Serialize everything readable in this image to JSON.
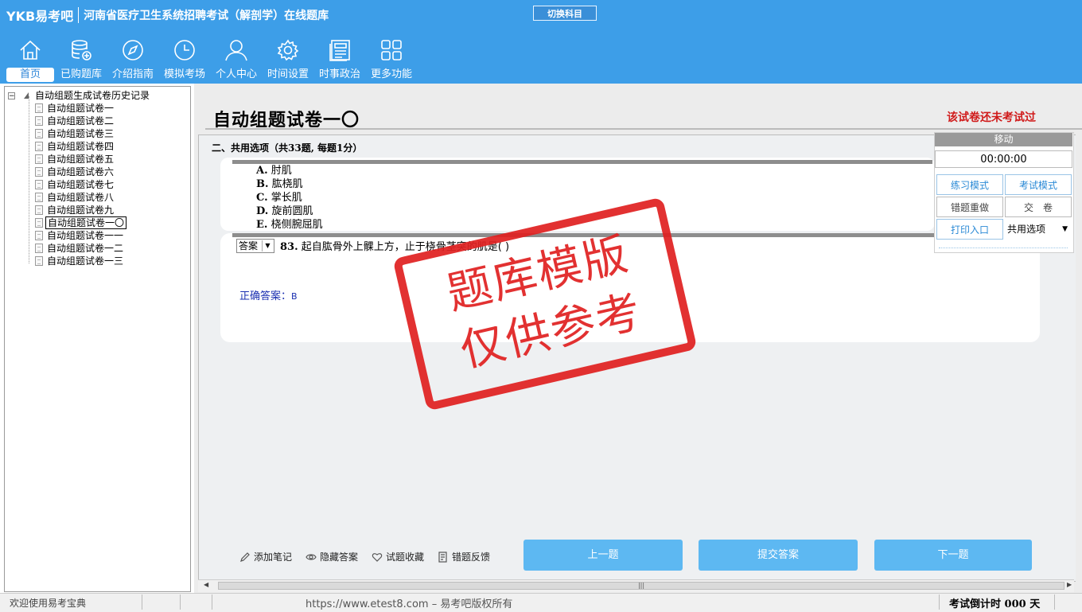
{
  "header": {
    "logo": "YKB易考吧",
    "title": "河南省医疗卫生系统招聘考试（解剖学）在线题库",
    "switch_label": "切换科目",
    "nav": [
      {
        "label": "首页",
        "icon": "home-icon"
      },
      {
        "label": "已购题库",
        "icon": "database-icon"
      },
      {
        "label": "介绍指南",
        "icon": "compass-icon"
      },
      {
        "label": "模拟考场",
        "icon": "clock-icon"
      },
      {
        "label": "个人中心",
        "icon": "user-icon"
      },
      {
        "label": "时间设置",
        "icon": "gear-icon"
      },
      {
        "label": "时事政治",
        "icon": "news-icon"
      },
      {
        "label": "更多功能",
        "icon": "grid-icon"
      }
    ]
  },
  "tree": {
    "root": "自动组题生成试卷历史记录",
    "items": [
      "自动组题试卷一",
      "自动组题试卷二",
      "自动组题试卷三",
      "自动组题试卷四",
      "自动组题试卷五",
      "自动组题试卷六",
      "自动组题试卷七",
      "自动组题试卷八",
      "自动组题试卷九",
      "自动组题试卷一〇",
      "自动组题试卷一一",
      "自动组题试卷一二",
      "自动组题试卷一三"
    ],
    "selected_index": 9
  },
  "exam": {
    "title": "自动组题试卷一〇",
    "status": "该试卷还未考试过",
    "section": "二、共用选项（共33题, 每题1分）",
    "options": [
      {
        "key": "A.",
        "text": "肘肌"
      },
      {
        "key": "B.",
        "text": "肱桡肌"
      },
      {
        "key": "C.",
        "text": "掌长肌"
      },
      {
        "key": "D.",
        "text": "旋前圆肌"
      },
      {
        "key": "E.",
        "text": "桡侧腕屈肌"
      }
    ],
    "answer_select": "答案",
    "question_number": "83.",
    "question_text": "起自肱骨外上髁上方，止于桡骨茎突的肌是(  )",
    "correct_label": "正确答案：",
    "correct_value": "B"
  },
  "panel": {
    "move": "移动",
    "timer": "00:00:00",
    "practice_mode": "练习模式",
    "exam_mode": "考试模式",
    "redo_wrong": "错题重做",
    "submit_paper": "交　卷",
    "print": "打印入口",
    "shared_option": "共用选项"
  },
  "actions": {
    "add_note": "添加笔记",
    "hide_answer": "隐藏答案",
    "favorite": "试题收藏",
    "feedback": "错题反馈",
    "prev": "上一题",
    "submit": "提交答案",
    "next": "下一题"
  },
  "footer": {
    "welcome": "欢迎使用易考宝典",
    "copyright": "https://www.etest8.com – 易考吧版权所有",
    "countdown": "考试倒计时 000 天"
  },
  "stamp": {
    "line1": "题库模版",
    "line2": "仅供参考"
  },
  "colors": {
    "header": "#3d9ee8",
    "button": "#5db8f2",
    "status": "#d01a1a",
    "stamp": "#e02020"
  }
}
